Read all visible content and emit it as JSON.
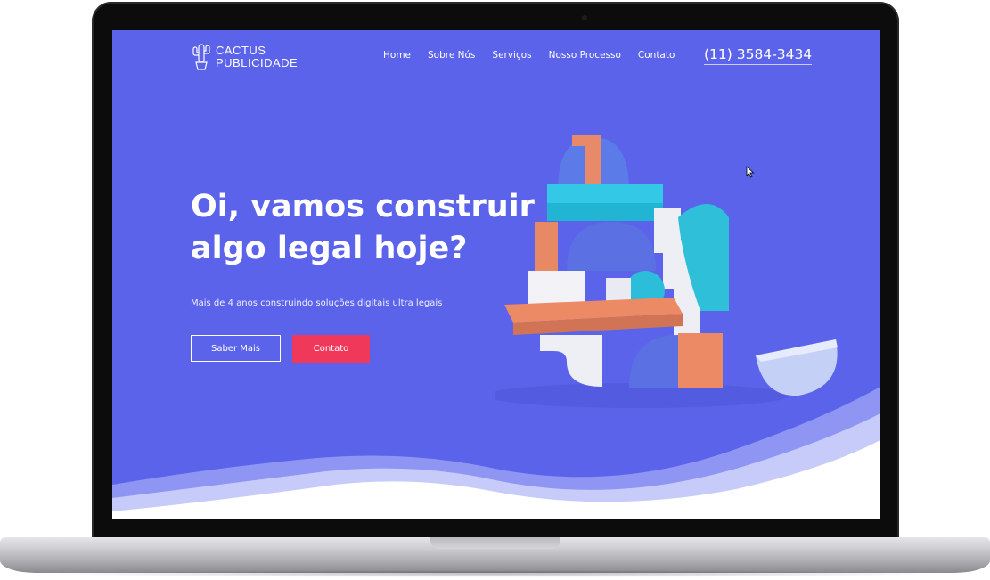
{
  "site": {
    "logo": {
      "line1": "CACTUS",
      "line2": "PUBLICIDADE",
      "icon": "cactus-icon"
    },
    "nav": [
      "Home",
      "Sobre Nós",
      "Serviços",
      "Nosso Processo",
      "Contato"
    ],
    "phone": "(11) 3584-3434"
  },
  "hero": {
    "title": "Oi, vamos construir algo legal hoje?",
    "subtitle": "Mais de 4 anos construindo soluções digitais ultra legais",
    "buttons": {
      "primary": "Saber Mais",
      "secondary": "Contato"
    }
  },
  "colors": {
    "background": "#5b63ea",
    "accent": "#f0395a",
    "text": "#ffffff"
  }
}
